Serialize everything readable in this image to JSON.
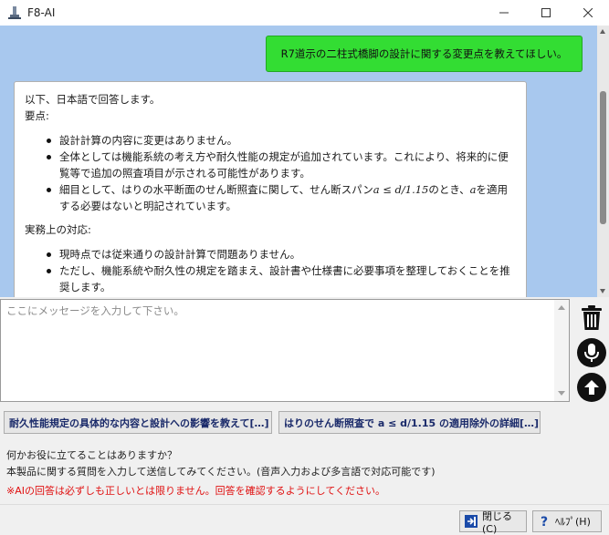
{
  "window": {
    "title": "F8-AI",
    "minimize_glyph": "—",
    "maximize_glyph": "☐",
    "close_glyph": "✕"
  },
  "chat": {
    "user_message": "R7道示の二柱式橋脚の設計に関する変更点を教えてほしい。",
    "ai_message": {
      "intro": "以下、日本語で回答します。",
      "heading1": "要点:",
      "points": [
        "設計計算の内容に変更はありません。",
        "全体としては機能系統の考え方や耐久性能の規定が追加されています。これにより、将来的に便覧等で追加の照査項目が示される可能性があります。",
        {
          "pre": "細目として、はりの水平断面のせん断照査に関して、せん断スパン",
          "math1": "a ≤ d/1.15",
          "mid": "のとき、",
          "math2": "a",
          "post": "を適用する必要はないと明記されています。"
        }
      ],
      "heading2": "実務上の対応:",
      "actions": [
        "現時点では従来通りの設計計算で問題ありません。",
        "ただし、機能系統や耐久性の規定を踏まえ、設計書や仕様書に必要事項を整理しておくことを推奨します。"
      ]
    }
  },
  "input": {
    "placeholder": "ここにメッセージを入力して下さい。",
    "value": ""
  },
  "side_buttons": {
    "delete_icon": "trash-icon",
    "mic_icon": "microphone-icon",
    "send_icon": "arrow-up-icon"
  },
  "suggestions": [
    "耐久性能規定の具体的な内容と設計への影響を教えて[…]",
    "はりのせん断照査で a ≤ d/1.15 の適用除外の詳細[…]"
  ],
  "info": {
    "line1": "何かお役に立てることはありますか？",
    "line2": "本製品に関する質問を入力して送信してみてください。(音声入力および多言語で対応可能です)",
    "warning": "※AIの回答は必ずしも正しいとは限りません。回答を確認するようにしてください。"
  },
  "bottom": {
    "close_label": "閉じる(C)",
    "help_label": "ﾍﾙﾌﾟ(H)"
  },
  "colors": {
    "chat_bg": "#a8c8ee",
    "user_bubble": "#33dd33",
    "warning_text": "#e01010"
  }
}
